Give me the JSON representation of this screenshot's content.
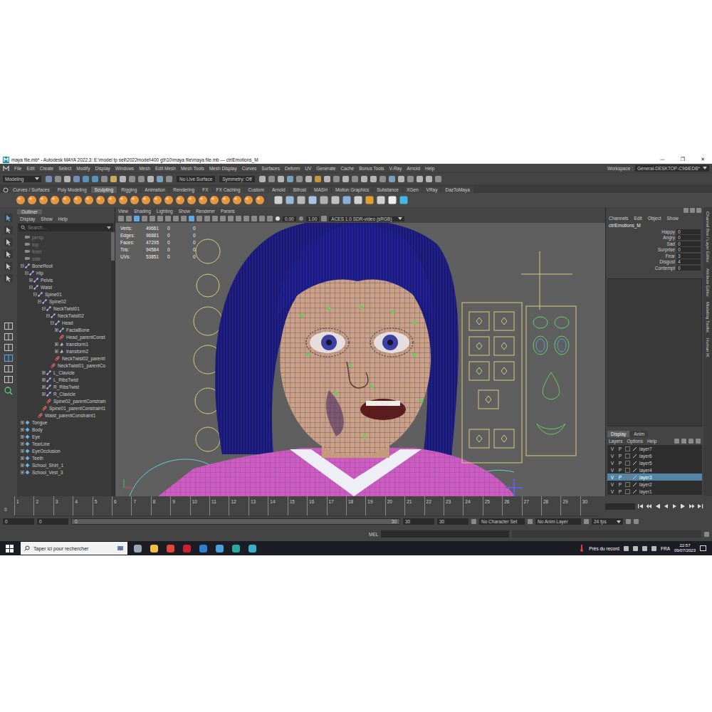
{
  "window": {
    "title": "maya file.mb* - Autodesk MAYA 2022.3: E:\\model tp sell\\2022model\\400 g9\\10\\maya file\\maya file.mb  ---  ctrlEmotions_M",
    "controls": [
      "—",
      "❐",
      "✕"
    ]
  },
  "menu_bar": {
    "items": [
      "File",
      "Edit",
      "Create",
      "Select",
      "Modify",
      "Display",
      "Windows",
      "Mesh",
      "Edit Mesh",
      "Mesh Tools",
      "Mesh Display",
      "Curves",
      "Surfaces",
      "Deform",
      "UV",
      "Generate",
      "Cache",
      "Bonus Tools",
      "V-Ray",
      "Arnold",
      "Help"
    ],
    "workspace_label": "Workspace :",
    "workspace": "General-DESKTOP-C96IEDB*"
  },
  "status_line": {
    "mode": "Modeling",
    "live_surface": "No Live Surface",
    "symmetry": "Symmetry: Off"
  },
  "shelf": {
    "tabs": [
      {
        "label": "Curves / Surfaces",
        "selected": false
      },
      {
        "label": "Poly Modeling",
        "selected": false
      },
      {
        "label": "Sculpting",
        "selected": true
      },
      {
        "label": "Rigging",
        "selected": false
      },
      {
        "label": "Animation",
        "selected": false
      },
      {
        "label": "Rendering",
        "selected": false
      },
      {
        "label": "FX",
        "selected": false
      },
      {
        "label": "FX Caching",
        "selected": false
      },
      {
        "label": "Custom",
        "selected": false
      },
      {
        "label": "Arnold",
        "selected": false
      },
      {
        "label": "Bifrost",
        "selected": false
      },
      {
        "label": "MASH",
        "selected": false
      },
      {
        "label": "Motion Graphics",
        "selected": false
      },
      {
        "label": "Substance",
        "selected": false
      },
      {
        "label": "XGen",
        "selected": false
      },
      {
        "label": "VRay",
        "selected": false
      },
      {
        "label": "DazToMaya",
        "selected": false
      }
    ]
  },
  "outliner": {
    "title": "Outliner",
    "menus": [
      "Display",
      "Show",
      "Help"
    ],
    "search_placeholder": "Search...",
    "items": [
      {
        "name": "persp",
        "depth": 0,
        "kind": "camera",
        "expander": "none",
        "dimmed": true
      },
      {
        "name": "top",
        "depth": 0,
        "kind": "camera",
        "expander": "none",
        "dimmed": true
      },
      {
        "name": "front",
        "depth": 0,
        "kind": "camera",
        "expander": "none",
        "dimmed": true
      },
      {
        "name": "side",
        "depth": 0,
        "kind": "camera",
        "expander": "none",
        "dimmed": true
      },
      {
        "name": "BoneRoot",
        "depth": 0,
        "kind": "joint",
        "expander": "open",
        "dimmed": false
      },
      {
        "name": "Hip",
        "depth": 1,
        "kind": "joint",
        "expander": "open",
        "dimmed": false
      },
      {
        "name": "Pelvis",
        "depth": 2,
        "kind": "joint",
        "expander": "closed",
        "dimmed": false
      },
      {
        "name": "Waist",
        "depth": 2,
        "kind": "joint",
        "expander": "open",
        "dimmed": false
      },
      {
        "name": "Spine01",
        "depth": 3,
        "kind": "joint",
        "expander": "open",
        "dimmed": false
      },
      {
        "name": "Spine02",
        "depth": 4,
        "kind": "joint",
        "expander": "open",
        "dimmed": false
      },
      {
        "name": "NeckTwist01",
        "depth": 5,
        "kind": "joint",
        "expander": "open",
        "dimmed": false
      },
      {
        "name": "NeckTwist02",
        "depth": 6,
        "kind": "joint",
        "expander": "open",
        "dimmed": false
      },
      {
        "name": "Head",
        "depth": 7,
        "kind": "joint",
        "expander": "open",
        "dimmed": false
      },
      {
        "name": "FacialBone",
        "depth": 8,
        "kind": "joint",
        "expander": "closed",
        "dimmed": false
      },
      {
        "name": "Head_parentConst",
        "depth": 8,
        "kind": "constraint",
        "expander": "none",
        "dimmed": false
      },
      {
        "name": "transform1",
        "depth": 8,
        "kind": "transform",
        "expander": "closed",
        "dimmed": false
      },
      {
        "name": "transform2",
        "depth": 8,
        "kind": "transform",
        "expander": "closed",
        "dimmed": false
      },
      {
        "name": "NeckTwist02_parentI",
        "depth": 7,
        "kind": "constraint",
        "expander": "none",
        "dimmed": false
      },
      {
        "name": "NeckTwist01_parentCo",
        "depth": 6,
        "kind": "constraint",
        "expander": "none",
        "dimmed": false
      },
      {
        "name": "L_Clavicle",
        "depth": 5,
        "kind": "joint",
        "expander": "closed",
        "dimmed": false
      },
      {
        "name": "L_RibsTwist",
        "depth": 5,
        "kind": "joint",
        "expander": "closed",
        "dimmed": false
      },
      {
        "name": "R_RibsTwist",
        "depth": 5,
        "kind": "joint",
        "expander": "closed",
        "dimmed": false
      },
      {
        "name": "R_Clavicle",
        "depth": 5,
        "kind": "joint",
        "expander": "closed",
        "dimmed": false
      },
      {
        "name": "Spine02_parentConstrain",
        "depth": 5,
        "kind": "constraint",
        "expander": "none",
        "dimmed": false
      },
      {
        "name": "Spine01_parentConstraint1",
        "depth": 4,
        "kind": "constraint",
        "expander": "none",
        "dimmed": false
      },
      {
        "name": "Waist_parentConstraint1",
        "depth": 3,
        "kind": "constraint",
        "expander": "none",
        "dimmed": false
      },
      {
        "name": "Tongue",
        "depth": 0,
        "kind": "mesh",
        "expander": "closed",
        "dimmed": false
      },
      {
        "name": "Body",
        "depth": 0,
        "kind": "mesh",
        "expander": "closed",
        "dimmed": false
      },
      {
        "name": "Eye",
        "depth": 0,
        "kind": "mesh",
        "expander": "closed",
        "dimmed": false
      },
      {
        "name": "TearLine",
        "depth": 0,
        "kind": "mesh",
        "expander": "closed",
        "dimmed": false
      },
      {
        "name": "EyeOcclusion",
        "depth": 0,
        "kind": "mesh",
        "expander": "closed",
        "dimmed": false
      },
      {
        "name": "Teeth",
        "depth": 0,
        "kind": "mesh",
        "expander": "closed",
        "dimmed": false
      },
      {
        "name": "School_Shirt_1",
        "depth": 0,
        "kind": "mesh",
        "expander": "closed",
        "dimmed": false
      },
      {
        "name": "School_Vest_3",
        "depth": 0,
        "kind": "mesh",
        "expander": "closed",
        "dimmed": false
      }
    ]
  },
  "viewport": {
    "menus": [
      "View",
      "Shading",
      "Lighting",
      "Show",
      "Renderer",
      "Panels"
    ],
    "exposure": "0.00",
    "gamma": "1.00",
    "color_space": "ACES 1.0 SDR-video (sRGB)",
    "hud": [
      {
        "label": "Verts:",
        "value": "49661",
        "selected": "0",
        "uv": "0"
      },
      {
        "label": "Edges:",
        "value": "96881",
        "selected": "0",
        "uv": "0"
      },
      {
        "label": "Faces:",
        "value": "47295",
        "selected": "0",
        "uv": "0"
      },
      {
        "label": "Tris:",
        "value": "94584",
        "selected": "0",
        "uv": "0"
      },
      {
        "label": "UVs:",
        "value": "53851",
        "selected": "0",
        "uv": "0"
      }
    ]
  },
  "channel_box": {
    "menus": [
      "Channels",
      "Edit",
      "Object",
      "Show"
    ],
    "node": "ctrlEmotions_M",
    "attributes": [
      {
        "name": "Happy",
        "value": "0"
      },
      {
        "name": "Angry",
        "value": "0"
      },
      {
        "name": "Sad",
        "value": "0"
      },
      {
        "name": "Surprise",
        "value": "0"
      },
      {
        "name": "Fear",
        "value": "3"
      },
      {
        "name": "Disgust",
        "value": "4"
      },
      {
        "name": "Contempt",
        "value": "0"
      }
    ]
  },
  "layer_editor": {
    "tabs": [
      {
        "label": "Display",
        "selected": true
      },
      {
        "label": "Anim",
        "selected": false
      }
    ],
    "menus": [
      "Layers",
      "Options",
      "Help"
    ],
    "layers": [
      {
        "name": "layer7",
        "v": "V",
        "p": "P",
        "selected": false
      },
      {
        "name": "layer6",
        "v": "V",
        "p": "P",
        "selected": false
      },
      {
        "name": "layer5",
        "v": "V",
        "p": "P",
        "selected": false
      },
      {
        "name": "layer4",
        "v": "V",
        "p": "P",
        "selected": false
      },
      {
        "name": "layer3",
        "v": "V",
        "p": "P",
        "selected": true
      },
      {
        "name": "layer2",
        "v": "V",
        "p": "P",
        "selected": false
      },
      {
        "name": "layer1",
        "v": "V",
        "p": "P",
        "selected": false
      }
    ]
  },
  "side_tabs": [
    "Channel Box / Layer Editor",
    "Attribute Editor",
    "Modeling Toolkit",
    "Human IK"
  ],
  "time_slider": {
    "current": "0",
    "frames": [
      "1",
      "2",
      "3",
      "4",
      "5",
      "6",
      "7",
      "8",
      "9",
      "10",
      "11",
      "12",
      "13",
      "14",
      "15",
      "16",
      "17",
      "18",
      "19",
      "20",
      "21",
      "22",
      "23",
      "24",
      "25",
      "26",
      "27",
      "28",
      "29",
      "30"
    ]
  },
  "range_slider": {
    "start": "0",
    "anim_start": "0",
    "range_start": "0",
    "range_end": "30",
    "anim_end": "30",
    "end": "30",
    "character_set": "No Character Set",
    "anim_layer": "No Anim Layer",
    "fps": "24 fps"
  },
  "command_line": {
    "language": "MEL"
  },
  "taskbar": {
    "search": "Taper ici pour rechercher",
    "weather": "Près du record",
    "language": "FRA",
    "time": "22:57",
    "date": "09/07/2023"
  }
}
